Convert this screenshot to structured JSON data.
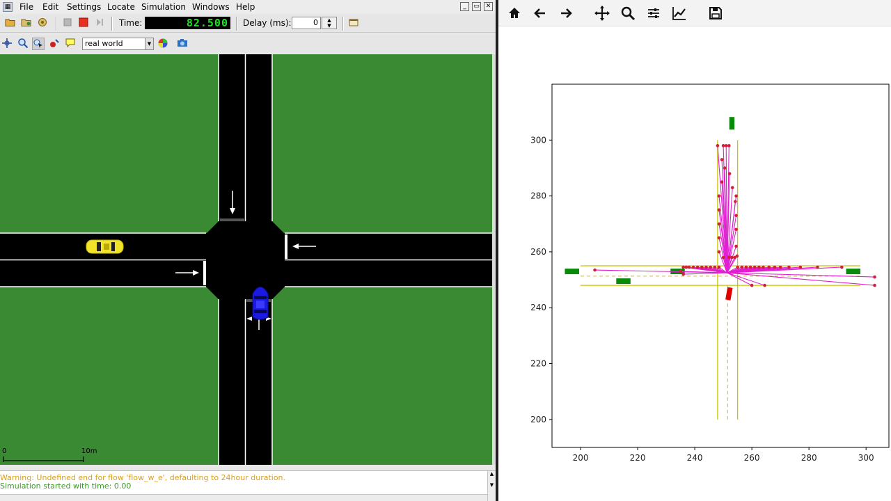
{
  "sumo": {
    "menu": [
      "File",
      "Edit",
      "Settings",
      "Locate",
      "Simulation",
      "Windows",
      "Help"
    ],
    "time_label": "Time:",
    "time_value": "82.500",
    "delay_label": "Delay (ms):",
    "delay_value": "0",
    "scheme": "real world",
    "scale_bar": {
      "start": "0",
      "end": "10m"
    },
    "log": {
      "warning": "Warning: Undefined end for flow 'flow_w_e', defaulting to 24hour duration.",
      "info": "Simulation started with time: 0.00"
    },
    "vehicles": [
      {
        "name": "yellow-car",
        "color": "#f2e22a"
      },
      {
        "name": "blue-car",
        "color": "#1a1ae0"
      }
    ],
    "colors": {
      "grass": "#3a8a33",
      "road": "#000000",
      "lane_mark": "#ffffff"
    },
    "toolbar_icons": [
      "open-icon",
      "reload-icon",
      "save-icon",
      "pause-icon",
      "stop-icon",
      "step-icon",
      "locate-icon",
      "zoom-icon",
      "select-icon",
      "vehicle-icon",
      "tooltip-icon",
      "color-wheel-icon",
      "camera-icon"
    ]
  },
  "plot": {
    "toolbar_icons": [
      "home-icon",
      "back-icon",
      "forward-icon",
      "pan-icon",
      "zoom-icon",
      "configure-icon",
      "edit-curves-icon",
      "save-icon"
    ],
    "chart_data": {
      "type": "scatter",
      "title": "",
      "xlabel": "",
      "ylabel": "",
      "xlim": [
        190,
        308
      ],
      "ylim": [
        190,
        320
      ],
      "xticks": [
        "200",
        "220",
        "240",
        "260",
        "280",
        "300"
      ],
      "yticks": [
        "200",
        "220",
        "240",
        "260",
        "280",
        "300"
      ],
      "road_lines": [
        {
          "from": [
            200,
            255
          ],
          "to": [
            298,
            255
          ]
        },
        {
          "from": [
            200,
            248
          ],
          "to": [
            298,
            248
          ]
        },
        {
          "from": [
            248,
            200
          ],
          "to": [
            248,
            300
          ]
        },
        {
          "from": [
            255,
            200
          ],
          "to": [
            255,
            300
          ]
        }
      ],
      "center_lines": [
        {
          "from": [
            200,
            251.3
          ],
          "to": [
            298,
            251.3
          ]
        },
        {
          "from": [
            251.5,
            200
          ],
          "to": [
            251.5,
            248
          ]
        }
      ],
      "ego": {
        "x": 251.3,
        "y": 252.5,
        "color": "#e00000"
      },
      "ego_box": {
        "x": 252,
        "y": 245,
        "w": 1.8,
        "h": 4.5
      },
      "obstacles": [
        {
          "x": 197,
          "y": 253,
          "w": 5,
          "h": 2
        },
        {
          "x": 215,
          "y": 249.5,
          "w": 5,
          "h": 2
        },
        {
          "x": 234,
          "y": 253,
          "w": 5,
          "h": 2
        },
        {
          "x": 295.5,
          "y": 253,
          "w": 5,
          "h": 2
        },
        {
          "x": 253,
          "y": 306,
          "w": 1.8,
          "h": 4.5
        }
      ],
      "sample_points": [
        [
          205,
          253.5
        ],
        [
          236,
          254.5
        ],
        [
          237,
          254.5
        ],
        [
          238,
          254.5
        ],
        [
          239.5,
          254.5
        ],
        [
          241,
          254.5
        ],
        [
          242.5,
          254.5
        ],
        [
          244,
          254.5
        ],
        [
          245.5,
          254.5
        ],
        [
          247,
          254.5
        ],
        [
          248.5,
          254.5
        ],
        [
          255,
          254.5
        ],
        [
          256.5,
          254.5
        ],
        [
          258,
          254.5
        ],
        [
          259.5,
          254.5
        ],
        [
          261,
          254.5
        ],
        [
          262.5,
          254.5
        ],
        [
          264,
          254.5
        ],
        [
          266,
          254.5
        ],
        [
          268,
          254.5
        ],
        [
          270,
          254.5
        ],
        [
          273,
          254.5
        ],
        [
          277,
          254.5
        ],
        [
          283,
          254.5
        ],
        [
          291.5,
          254.5
        ],
        [
          303,
          251
        ],
        [
          303,
          248
        ],
        [
          260,
          248
        ],
        [
          264.5,
          248
        ],
        [
          235,
          253
        ],
        [
          236,
          252
        ],
        [
          248,
          298
        ],
        [
          249.5,
          293
        ],
        [
          250,
          298
        ],
        [
          251,
          298
        ],
        [
          252,
          298
        ],
        [
          248.5,
          280
        ],
        [
          248.5,
          275
        ],
        [
          248.5,
          270
        ],
        [
          248.5,
          265
        ],
        [
          248.5,
          260
        ],
        [
          254.5,
          280
        ],
        [
          254.5,
          273
        ],
        [
          254.5,
          268
        ],
        [
          254.5,
          262
        ],
        [
          249.5,
          285
        ],
        [
          250.5,
          290
        ],
        [
          252.2,
          288
        ],
        [
          253.2,
          283
        ],
        [
          254.2,
          278
        ],
        [
          254.8,
          258.5
        ],
        [
          254,
          258
        ],
        [
          253,
          258
        ],
        [
          252,
          258
        ],
        [
          250,
          258
        ]
      ],
      "trajectory_color": "#e020d0",
      "point_color": "#d0203a"
    }
  }
}
